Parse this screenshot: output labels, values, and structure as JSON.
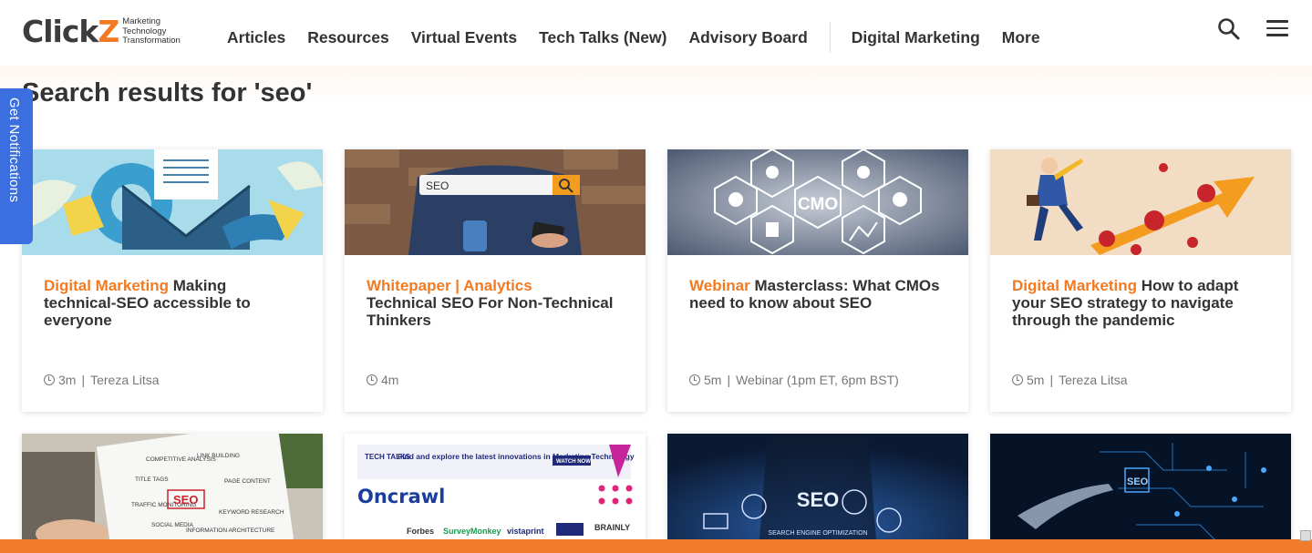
{
  "brand": {
    "logo_text_main": "Click",
    "logo_text_accent": "Z",
    "tagline": [
      "Marketing",
      "Technology",
      "Transformation"
    ],
    "accent_color": "#f37a20",
    "notification_color": "#3b6fe0"
  },
  "nav": {
    "items": [
      "Articles",
      "Resources",
      "Virtual Events",
      "Tech Talks (New)",
      "Advisory Board"
    ],
    "secondary": [
      "Digital Marketing",
      "More"
    ]
  },
  "header_icons": [
    "search-icon",
    "hamburger-menu-icon"
  ],
  "side_tab": {
    "label": "Get Notifications"
  },
  "page": {
    "title": "Search results for 'seo'"
  },
  "results": [
    {
      "category": "Digital Marketing",
      "title": "Making technical-SEO accessible to everyone",
      "read_time": "3m",
      "author": "Tereza Litsa"
    },
    {
      "category": "Whitepaper | Analytics",
      "title": "Technical SEO For Non-Technical Thinkers",
      "read_time": "4m",
      "author": ""
    },
    {
      "category": "Webinar",
      "title": "Masterclass: What CMOs need to know about SEO",
      "read_time": "5m",
      "author": "Webinar (1pm ET, 6pm BST)"
    },
    {
      "category": "Digital Marketing",
      "title": "How to adapt your SEO strategy to navigate through the pandemic",
      "read_time": "5m",
      "author": "Tereza Litsa"
    }
  ],
  "image_text": {
    "seo_search": "SEO",
    "cmo": "CMO",
    "notepad": "SEO",
    "notepad_words": [
      "COMPETITIVE ANALYSIS",
      "LINK BUILDING",
      "TITLE TAGS",
      "PAGE CONTENT",
      "TRAFFIC MONITORING",
      "KEYWORD RESEARCH",
      "SOCIAL MEDIA",
      "INFORMATION ARCHITECTURE"
    ],
    "techtalks_logo": "TECH TALKS",
    "techtalks_banner": "Find and explore the latest innovations in Marketing Technology",
    "watch_now": "WATCH NOW",
    "oncrawl": "Oncrawl",
    "sponsors": [
      "Forbes",
      "SurveyMonkey",
      "vistaprint",
      "BRAINLY"
    ],
    "seo_big": "SEO",
    "seo_subtitle": "SEARCH ENGINE OPTIMIZATION",
    "circuit_seo": "SEO"
  }
}
